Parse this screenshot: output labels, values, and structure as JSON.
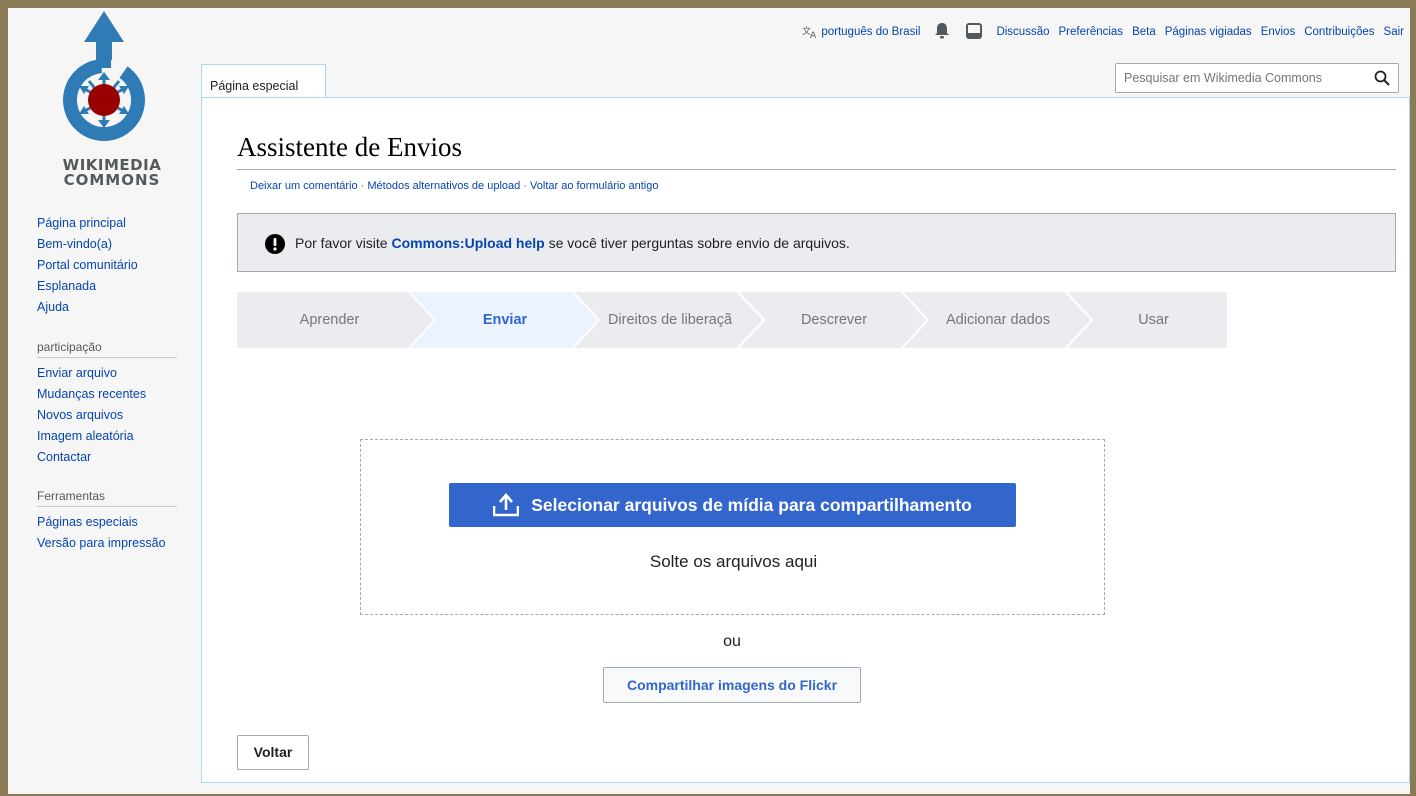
{
  "logo": {
    "line1": "WIKIMEDIA",
    "line2": "COMMONS"
  },
  "sidebar": {
    "main_items": [
      {
        "label": "Página principal"
      },
      {
        "label": "Bem-vindo(a)"
      },
      {
        "label": "Portal comunitário"
      },
      {
        "label": "Esplanada"
      },
      {
        "label": "Ajuda"
      }
    ],
    "participation": {
      "heading": "participação",
      "items": [
        {
          "label": "Enviar arquivo"
        },
        {
          "label": "Mudanças recentes"
        },
        {
          "label": "Novos arquivos"
        },
        {
          "label": "Imagem aleatória"
        },
        {
          "label": "Contactar"
        }
      ]
    },
    "tools": {
      "heading": "Ferramentas",
      "items": [
        {
          "label": "Páginas especiais"
        },
        {
          "label": "Versão para impressão"
        }
      ]
    }
  },
  "personal_bar": {
    "language": "português do Brasil",
    "links": [
      "Discussão",
      "Preferências",
      "Beta",
      "Páginas vigiadas",
      "Envios",
      "Contribuições",
      "Sair"
    ]
  },
  "tab": {
    "label": "Página especial"
  },
  "search": {
    "placeholder": "Pesquisar em Wikimedia Commons"
  },
  "page": {
    "title": "Assistente de Envios",
    "sublinks": [
      "Deixar um comentário",
      "Métodos alternativos de upload",
      "Voltar ao formulário antigo"
    ],
    "sublink_separator": " · "
  },
  "notice": {
    "before": "Por favor visite ",
    "link": "Commons:Upload help",
    "after": " se você tiver perguntas sobre envio de arquivos."
  },
  "steps": {
    "active_index": 1,
    "items": [
      "Aprender",
      "Enviar",
      "Direitos de liberaçã",
      "Descrever",
      "Adicionar dados",
      "Usar"
    ]
  },
  "upload": {
    "select_button": "Selecionar arquivos de mídia para compartilhamento",
    "drop_text": "Solte os arquivos aqui",
    "or_text": "ou",
    "flickr_button": "Compartilhar imagens do Flickr"
  },
  "footer": {
    "back_button": "Voltar"
  },
  "colors": {
    "link": "#0645ad",
    "progressive": "#3366cc",
    "active_step_bg": "#eaf3ff",
    "inactive_step_bg": "#eaecf0",
    "logo_blue": "#2f7bb6",
    "logo_red": "#990000"
  }
}
